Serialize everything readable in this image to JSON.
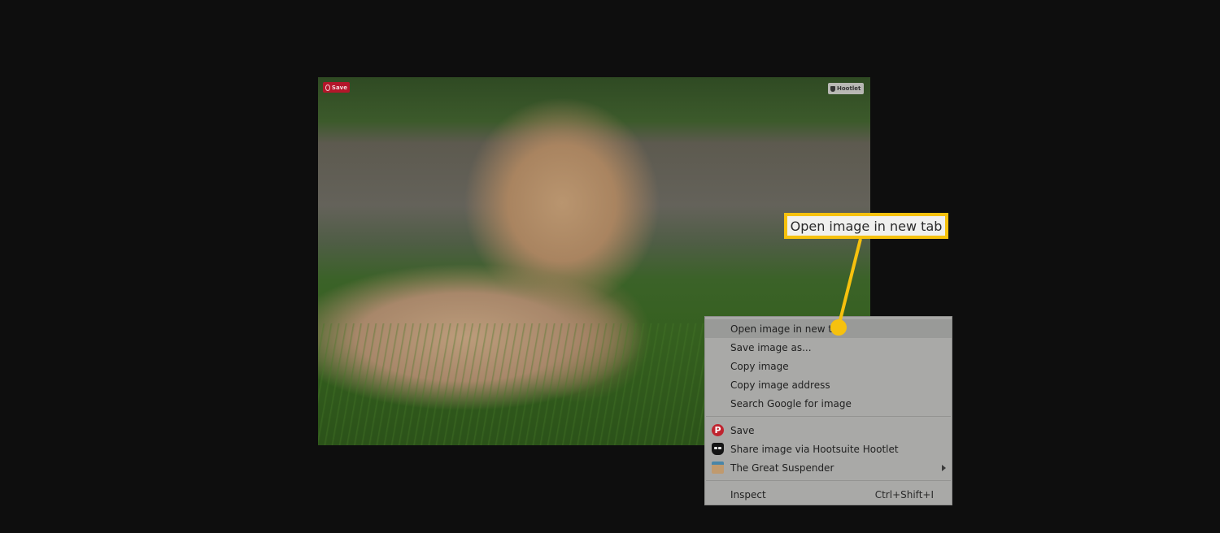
{
  "photo": {
    "description": "Fluffy apricot poodle puppy lying on grass",
    "overlay_buttons": {
      "pinterest_save": {
        "icon": "pinterest-icon",
        "label": "Save",
        "color": "#b3162a"
      },
      "hootlet": {
        "icon": "hootsuite-owl-icon",
        "label": "Hootlet"
      }
    }
  },
  "context_menu": {
    "groups": [
      [
        {
          "label": "Open image in new tab",
          "highlighted": true
        },
        {
          "label": "Save image as..."
        },
        {
          "label": "Copy image"
        },
        {
          "label": "Copy image address"
        },
        {
          "label": "Search Google for image"
        }
      ],
      [
        {
          "label": "Save",
          "icon": "pinterest-icon"
        },
        {
          "label": "Share image via Hootsuite Hootlet",
          "icon": "hootsuite-owl-icon"
        },
        {
          "label": "The Great Suspender",
          "icon": "great-suspender-icon",
          "submenu": true
        }
      ],
      [
        {
          "label": "Inspect",
          "shortcut": "Ctrl+Shift+I"
        }
      ]
    ]
  },
  "callout": {
    "text": "Open image in new tab",
    "color": "#f6c10e"
  }
}
